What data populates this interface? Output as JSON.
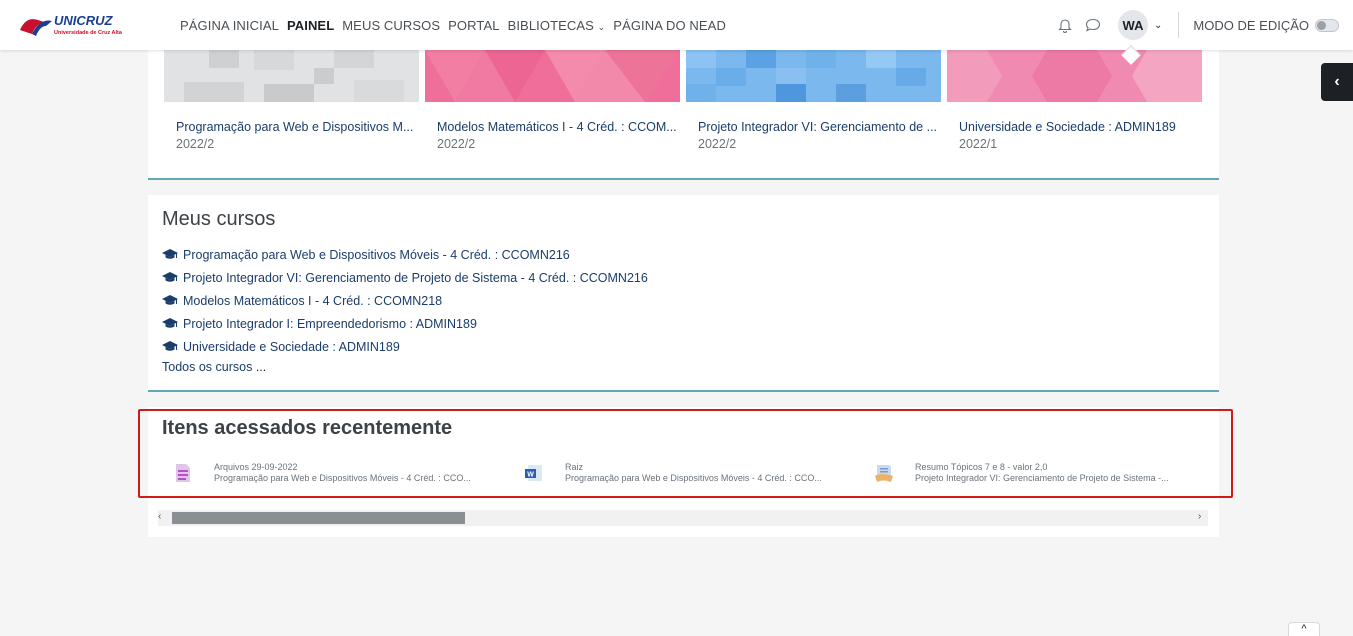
{
  "nav": {
    "logo_alt": "UNICRUZ",
    "logo_sub": "Universidade de Cruz Alta",
    "links": [
      "PÁGINA INICIAL",
      "PAINEL",
      "MEUS CURSOS",
      "PORTAL",
      "BIBLIOTECAS",
      "PÁGINA DO NEAD"
    ],
    "active": "PAINEL",
    "avatar_initials": "WA",
    "edit_mode_label": "MODO DE EDIÇÃO"
  },
  "course_cards": [
    {
      "name": "Programação para Web e Dispositivos M...",
      "term": "2022/2",
      "pattern": "gray-squares"
    },
    {
      "name": "Modelos Matemáticos I - 4 Créd. : CCOM...",
      "term": "2022/2",
      "pattern": "pink-triangles"
    },
    {
      "name": "Projeto Integrador VI: Gerenciamento de ...",
      "term": "2022/2",
      "pattern": "blue-squares"
    },
    {
      "name": "Universidade e Sociedade : ADMIN189",
      "term": "2022/1",
      "pattern": "pink-hexagons"
    }
  ],
  "my_courses": {
    "title": "Meus cursos",
    "items": [
      "Programação para Web e Dispositivos Móveis - 4 Créd. : CCOMN216",
      "Projeto Integrador VI: Gerenciamento de Projeto de Sistema - 4 Créd. : CCOMN216",
      "Modelos Matemáticos I - 4 Créd. : CCOMN218",
      "Projeto Integrador I: Empreendedorismo : ADMIN189",
      "Universidade e Sociedade : ADMIN189"
    ],
    "all_courses": "Todos os cursos",
    "all_courses_suffix": "..."
  },
  "recent": {
    "title": "Itens acessados recentemente",
    "items": [
      {
        "name": "Arquivos 29-09-2022",
        "course": "Programação para Web e Dispositivos Móveis - 4 Créd. : CCO...",
        "icon": "file-icon"
      },
      {
        "name": "Raiz",
        "course": "Programação para Web e Dispositivos Móveis - 4 Créd. : CCO...",
        "icon": "word-doc-icon"
      },
      {
        "name": "Resumo Tópicos 7 e 8 - valor 2,0",
        "course": "Projeto Integrador VI: Gerenciamento de Projeto de Sistema -...",
        "icon": "assignment-icon"
      }
    ]
  },
  "colors": {
    "accent_border": "#5fa8b6",
    "highlight": "#d11a1a",
    "link": "#1a3d6b",
    "drawer": "#1d2125"
  }
}
